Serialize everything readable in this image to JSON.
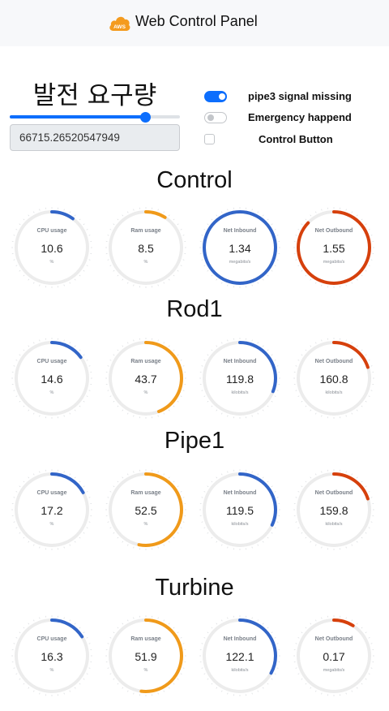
{
  "header": {
    "title": "Web Control Panel",
    "logo_text": "AWS",
    "logo_color": "#f49b1e"
  },
  "demand": {
    "title": "발전 요구량",
    "value": "66715.26520547949",
    "slider_fraction": 0.795
  },
  "switches": [
    {
      "label": "pipe3 signal missing",
      "on": true
    },
    {
      "label": "Emergency happend",
      "on": false
    }
  ],
  "control_button": {
    "label": "Control Button",
    "checked": false
  },
  "colors": {
    "blue": "#3265c8",
    "orange": "#f09a1a",
    "red": "#d6400c",
    "track": "#ececec",
    "accent": "#0d6efd"
  },
  "sections": [
    {
      "title": "Control",
      "gauges": [
        {
          "name": "CPU usage",
          "value": "10.6",
          "unit": "%",
          "fraction": 0.1,
          "color": "blue"
        },
        {
          "name": "Ram usage",
          "value": "8.5",
          "unit": "%",
          "fraction": 0.09,
          "color": "orange"
        },
        {
          "name": "Net Inbound",
          "value": "1.34",
          "unit": "megabits/s",
          "fraction": 1.0,
          "color": "blue"
        },
        {
          "name": "Net Outbound",
          "value": "1.55",
          "unit": "megabits/s",
          "fraction": 0.87,
          "color": "red"
        }
      ]
    },
    {
      "title": "Rod1",
      "gauges": [
        {
          "name": "CPU usage",
          "value": "14.6",
          "unit": "%",
          "fraction": 0.15,
          "color": "blue"
        },
        {
          "name": "Ram usage",
          "value": "43.7",
          "unit": "%",
          "fraction": 0.44,
          "color": "orange"
        },
        {
          "name": "Net Inbound",
          "value": "119.8",
          "unit": "kilobits/s",
          "fraction": 0.31,
          "color": "blue"
        },
        {
          "name": "Net Outbound",
          "value": "160.8",
          "unit": "kilobits/s",
          "fraction": 0.2,
          "color": "red"
        }
      ]
    },
    {
      "title": "Pipe1",
      "gauges": [
        {
          "name": "CPU usage",
          "value": "17.2",
          "unit": "%",
          "fraction": 0.17,
          "color": "blue"
        },
        {
          "name": "Ram usage",
          "value": "52.5",
          "unit": "%",
          "fraction": 0.53,
          "color": "orange"
        },
        {
          "name": "Net Inbound",
          "value": "119.5",
          "unit": "kilobits/s",
          "fraction": 0.32,
          "color": "blue"
        },
        {
          "name": "Net Outbound",
          "value": "159.8",
          "unit": "kilobits/s",
          "fraction": 0.2,
          "color": "red"
        }
      ]
    },
    {
      "title": "Turbine",
      "gauges": [
        {
          "name": "CPU usage",
          "value": "16.3",
          "unit": "%",
          "fraction": 0.16,
          "color": "blue"
        },
        {
          "name": "Ram usage",
          "value": "51.9",
          "unit": "%",
          "fraction": 0.52,
          "color": "orange"
        },
        {
          "name": "Net Inbound",
          "value": "122.1",
          "unit": "kilobits/s",
          "fraction": 0.33,
          "color": "blue"
        },
        {
          "name": "Net Outbound",
          "value": "0.17",
          "unit": "megabits/s",
          "fraction": 0.09,
          "color": "red"
        }
      ]
    }
  ]
}
